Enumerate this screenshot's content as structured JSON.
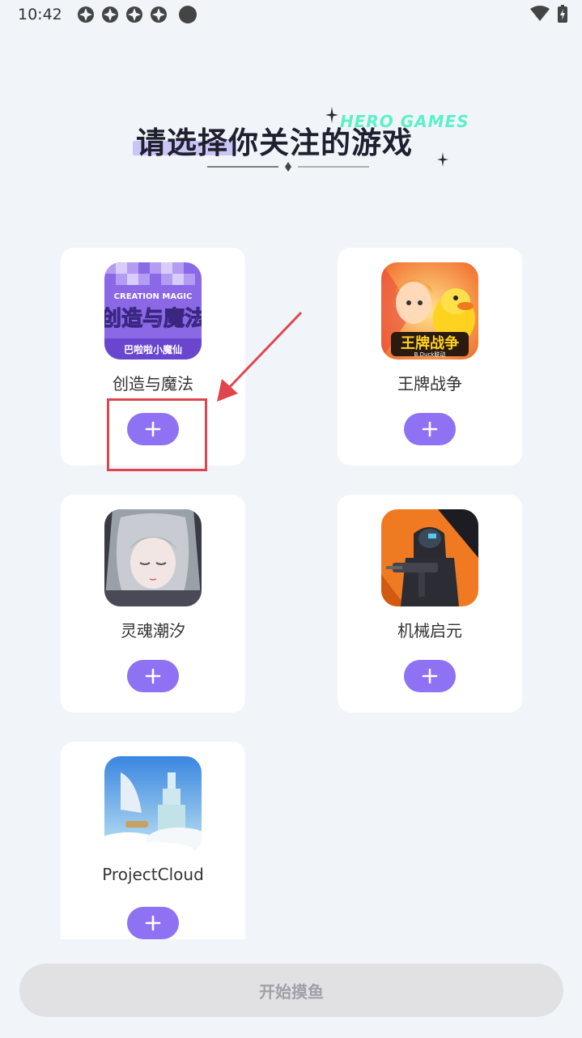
{
  "status_bar": {
    "time": "10:42",
    "notification_icons": [
      "app-notification-icon",
      "app-notification-icon",
      "app-notification-icon",
      "app-notification-icon"
    ],
    "wifi_icon": "wifi-icon",
    "battery_icon": "battery-charging-icon"
  },
  "header": {
    "title": "请选择你关注的游戏",
    "brand": "HERO GAMES"
  },
  "games": [
    {
      "name": "创造与魔法",
      "icon": "creation-magic-icon",
      "add_label": "+",
      "icon_text_top": "CREATION MAGIC",
      "icon_text_mid": "创造与魔法",
      "icon_text_bottom": "巴啦啦小魔仙"
    },
    {
      "name": "王牌战争",
      "icon": "ace-war-icon",
      "add_label": "+",
      "icon_text_mid": "王牌战争",
      "icon_text_bottom": "B.Duck联动"
    },
    {
      "name": "灵魂潮汐",
      "icon": "soul-tide-icon",
      "add_label": "+"
    },
    {
      "name": "机械启元",
      "icon": "mech-genesis-icon",
      "add_label": "+"
    },
    {
      "name": "ProjectCloud",
      "icon": "project-cloud-icon",
      "add_label": "+"
    }
  ],
  "start_button": {
    "label": "开始摸鱼"
  },
  "colors": {
    "background": "#f1f5f9",
    "accent": "#8f72f4",
    "annotation": "#e0454e",
    "start_disabled": "#e1e1e4"
  }
}
